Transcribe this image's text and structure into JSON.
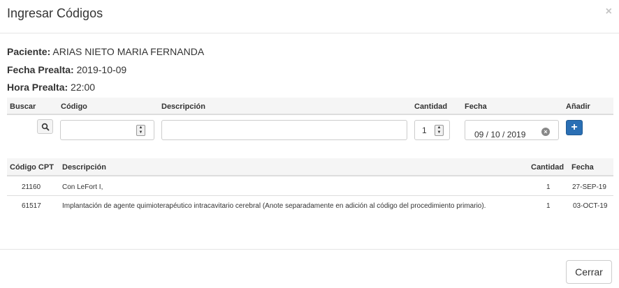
{
  "modal": {
    "title": "Ingresar Códigos",
    "close_glyph": "×"
  },
  "patient": {
    "paciente_label": "Paciente:",
    "paciente_value": "ARIAS NIETO MARIA FERNANDA",
    "fecha_label": "Fecha Prealta:",
    "fecha_value": "2019-10-09",
    "hora_label": "Hora Prealta:",
    "hora_value": "22:00"
  },
  "entry": {
    "headers": {
      "buscar": "Buscar",
      "codigo": "Código",
      "descripcion": "Descripción",
      "cantidad": "Cantidad",
      "fecha": "Fecha",
      "anadir": "Añadir"
    },
    "codigo_value": "",
    "descripcion_value": "",
    "cantidad_value": "1",
    "fecha_value": "09 / 10 / 2019",
    "add_glyph": "+"
  },
  "table": {
    "headers": {
      "codigo_cpt": "Código CPT",
      "descripcion": "Descripción",
      "cantidad": "Cantidad",
      "fecha": "Fecha"
    },
    "rows": [
      {
        "codigo": "21160",
        "descripcion": "Con LeFort I,",
        "cantidad": "1",
        "fecha": "27-SEP-19"
      },
      {
        "codigo": "61517",
        "descripcion": "Implantación de agente quimioterapéutico intracavitario cerebral (Anote separadamente en adición al código del procedimiento primario).",
        "cantidad": "1",
        "fecha": "03-OCT-19"
      }
    ]
  },
  "footer": {
    "cerrar_label": "Cerrar"
  },
  "icons": {
    "search": "search-icon",
    "add": "plus-icon",
    "close": "close-icon",
    "clear": "clear-icon",
    "spinner": "spinner-icon"
  },
  "colors": {
    "accent": "#2a6fb4",
    "header_bg": "#f5f5f5"
  }
}
